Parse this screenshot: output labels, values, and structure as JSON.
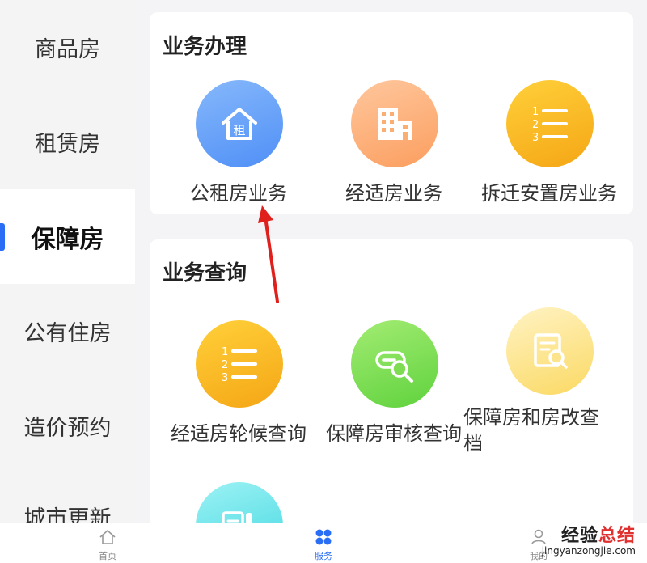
{
  "sidebar": {
    "items": [
      {
        "label": "商品房"
      },
      {
        "label": "租赁房"
      },
      {
        "label": "保障房"
      },
      {
        "label": "公有住房"
      },
      {
        "label": "造价预约"
      },
      {
        "label": "城市更新"
      }
    ],
    "active_index": 2,
    "accent_color": "#2a6ef5"
  },
  "sections": {
    "business": {
      "title": "业务办理",
      "tiles": [
        {
          "label": "公租房业务",
          "icon": "house-rent-icon",
          "icon_text": "租",
          "color": "#4f8ff6"
        },
        {
          "label": "经适房业务",
          "icon": "building-icon",
          "color": "#fb9e5f"
        },
        {
          "label": "拆迁安置房业务",
          "icon": "numbered-list-icon",
          "color": "#f5a615"
        }
      ]
    },
    "query": {
      "title": "业务查询",
      "tiles": [
        {
          "label": "经适房轮候查询",
          "icon": "numbered-list-icon",
          "color": "#f5a615"
        },
        {
          "label": "保障房审核查询",
          "icon": "search-card-icon",
          "color": "#5fd23d"
        },
        {
          "label": "保障房和房改查档",
          "icon": "document-search-icon",
          "color": "#fbd963"
        },
        {
          "label": "",
          "icon": "document-icon",
          "color": "#3fd7e0"
        }
      ]
    }
  },
  "bottom_nav": {
    "items": [
      {
        "label": "首页",
        "icon": "home-icon"
      },
      {
        "label": "服务",
        "icon": "grid-icon"
      },
      {
        "label": "我的",
        "icon": "user-icon"
      }
    ],
    "active_index": 1
  },
  "watermark": {
    "main_prefix": "经验",
    "main_suffix": "总结",
    "sub": "jingyanzongjie.com"
  }
}
